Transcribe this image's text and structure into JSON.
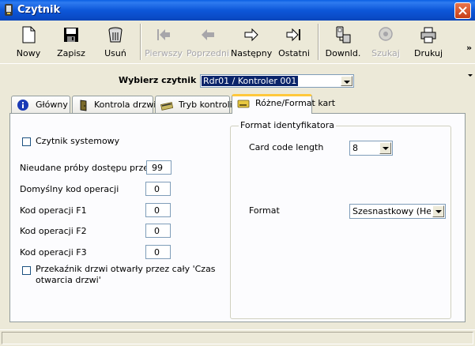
{
  "window": {
    "title": "Czytnik"
  },
  "toolbar": {
    "buttons": [
      {
        "label": "Nowy",
        "icon": "new-document-icon",
        "enabled": true
      },
      {
        "label": "Zapisz",
        "icon": "floppy-disk-icon",
        "enabled": true
      },
      {
        "label": "Usuń",
        "icon": "trash-bin-icon",
        "enabled": true
      },
      {
        "label": "Pierwszy",
        "icon": "first-record-icon",
        "enabled": false
      },
      {
        "label": "Poprzedni",
        "icon": "previous-record-icon",
        "enabled": false
      },
      {
        "label": "Następny",
        "icon": "next-record-icon",
        "enabled": true
      },
      {
        "label": "Ostatni",
        "icon": "last-record-icon",
        "enabled": true
      },
      {
        "label": "Downld.",
        "icon": "download-icon",
        "enabled": true
      },
      {
        "label": "Szukaj",
        "icon": "search-icon",
        "enabled": false
      },
      {
        "label": "Drukuj",
        "icon": "printer-icon",
        "enabled": true
      }
    ],
    "overflow": "»"
  },
  "reader_select": {
    "label": "Wybierz czytnik :",
    "value": "Rdr01 / Kontroler 001"
  },
  "tabs": [
    {
      "label": "Główny",
      "icon": "info-icon",
      "active": false
    },
    {
      "label": "Kontrola drzwi",
      "icon": "door-icon",
      "active": false
    },
    {
      "label": "Tryb kontroli",
      "icon": "card-swipe-icon",
      "active": false
    },
    {
      "label": "Różne/Format kart",
      "icon": "card-icon",
      "active": true
    }
  ],
  "form": {
    "system_reader": {
      "label": "Czytnik systemowy",
      "checked": false
    },
    "failed_attempts": {
      "label": "Nieudane próby dostępu przed a",
      "value": "99"
    },
    "default_op_code": {
      "label": "Domyślny kod operacji",
      "value": "0"
    },
    "op_f1": {
      "label": "Kod operacji F1",
      "value": "0"
    },
    "op_f2": {
      "label": "Kod operacji F2",
      "value": "0"
    },
    "op_f3": {
      "label": "Kod operacji F3",
      "value": "0"
    },
    "relay_open": {
      "label_line1": "Przekaźnik drzwi otwarły przez cały 'Czas",
      "label_line2": "otwarcia drzwi'",
      "checked": false
    }
  },
  "id_format": {
    "group_title": "Format identyfikatora",
    "card_code_length": {
      "label": "Card code length",
      "value": "8"
    },
    "format": {
      "label": "Format",
      "value": "Szesnastkowy (Hexa"
    }
  },
  "colors": {
    "titlebar": "#0A5FE3",
    "close": "#D54D23",
    "active_tab_accent": "#FFC83C",
    "selection": "#0A246A"
  }
}
